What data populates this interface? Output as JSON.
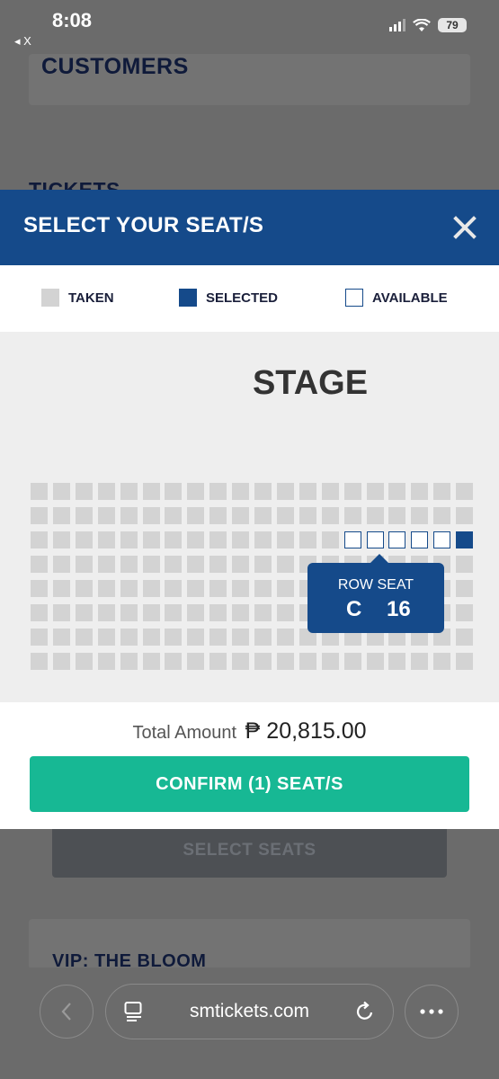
{
  "status_bar": {
    "time": "8:08",
    "back_app": "◂ X",
    "battery": "79"
  },
  "background": {
    "customers_heading": "CUSTOMERS",
    "tickets_heading": "TICKETS",
    "vip_heading": "VIP: THE BLOOM",
    "select_seats_label": "SELECT SEATS"
  },
  "modal": {
    "title": "SELECT YOUR SEAT/S",
    "legend": {
      "taken": "TAKEN",
      "selected": "SELECTED",
      "available": "AVAILABLE"
    },
    "stage_label": "STAGE",
    "seat_map": {
      "rows": 8,
      "cols": 20,
      "available_seats": [
        [
          2,
          14
        ],
        [
          2,
          15
        ],
        [
          2,
          16
        ],
        [
          2,
          17
        ],
        [
          2,
          18
        ]
      ],
      "selected_seats": [
        [
          2,
          19
        ]
      ]
    },
    "tooltip": {
      "label": "ROW SEAT",
      "row": "C",
      "seat": "16"
    },
    "total_label": "Total Amount",
    "total_amount": "₱ 20,815.00",
    "confirm_label": "CONFIRM (1) SEAT/S"
  },
  "browser": {
    "url": "smtickets.com"
  },
  "colors": {
    "primary": "#154a8a",
    "confirm": "#17b894",
    "taken": "#d3d3d3"
  }
}
